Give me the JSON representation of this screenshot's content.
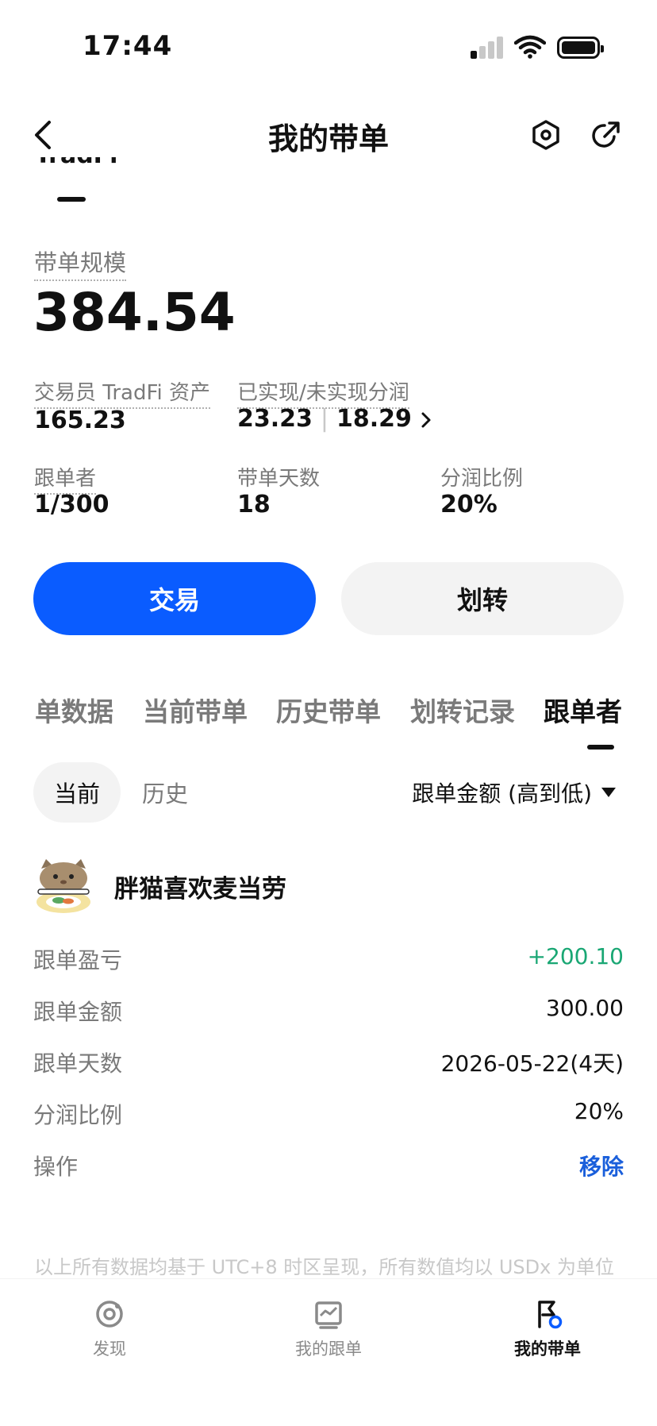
{
  "status_bar": {
    "time": "17:44"
  },
  "header": {
    "title": "我的带单"
  },
  "summary": {
    "scale_label": "带单规模",
    "scale_value": "384.54",
    "trader_assets_label": "交易员 TradFi 资产",
    "trader_assets_value": "165.23",
    "profit_share_label": "已实现/未实现分润",
    "realized": "23.23",
    "unrealized": "18.29",
    "followers_label": "跟单者",
    "followers_value": "1/300",
    "days_label": "带单天数",
    "days_value": "18",
    "share_ratio_label": "分润比例",
    "share_ratio_value": "20%"
  },
  "actions": {
    "trade": "交易",
    "transfer": "划转"
  },
  "tabs": [
    {
      "label": "单数据"
    },
    {
      "label": "当前带单"
    },
    {
      "label": "历史带单"
    },
    {
      "label": "划转记录"
    },
    {
      "label": "跟单者"
    }
  ],
  "subtabs": {
    "current": "当前",
    "history": "历史"
  },
  "sort": {
    "label": "跟单金额 (高到低)"
  },
  "follower": {
    "name": "胖猫喜欢麦当劳",
    "rows": [
      {
        "label": "跟单盈亏",
        "value": "+200.10"
      },
      {
        "label": "跟单金额",
        "value": "300.00"
      },
      {
        "label": "跟单天数",
        "value": "2026-05-22(4天)"
      },
      {
        "label": "分润比例",
        "value": "20%"
      },
      {
        "label": "操作",
        "value": "移除"
      }
    ]
  },
  "footnote": "以上所有数据均基于 UTC+8 时区呈现，所有数值均以 USDx 为单位",
  "bottom_nav": [
    {
      "label": "发现",
      "icon": "discover-icon"
    },
    {
      "label": "我的跟单",
      "icon": "chart-icon"
    },
    {
      "label": "我的带单",
      "icon": "flag-icon"
    }
  ],
  "colors": {
    "primary": "#0a5cff",
    "profit": "#1aa774",
    "action": "#1a5fdb"
  }
}
